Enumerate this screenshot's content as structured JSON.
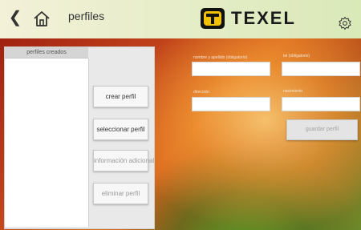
{
  "header": {
    "back_icon": "chevron-left-icon",
    "home_icon": "home-icon",
    "title": "perfiles",
    "logo_text": "TEXEL",
    "settings_icon": "gear-icon"
  },
  "profiles": {
    "list_header": "perfiles creados",
    "items": []
  },
  "actions": {
    "create": "crear perfil",
    "select": "seleccionar perfil",
    "additional_info": "información adicional",
    "delete": "eliminar perfil"
  },
  "form": {
    "name_label": "nombre y apellido (obligatorio)",
    "name_value": "",
    "phone_label": "tel (obligatorio)",
    "phone_value": "",
    "address_label": "dirección",
    "address_value": "",
    "birth_label": "nacimiento",
    "birth_value": "",
    "save": "guardar perfil"
  }
}
